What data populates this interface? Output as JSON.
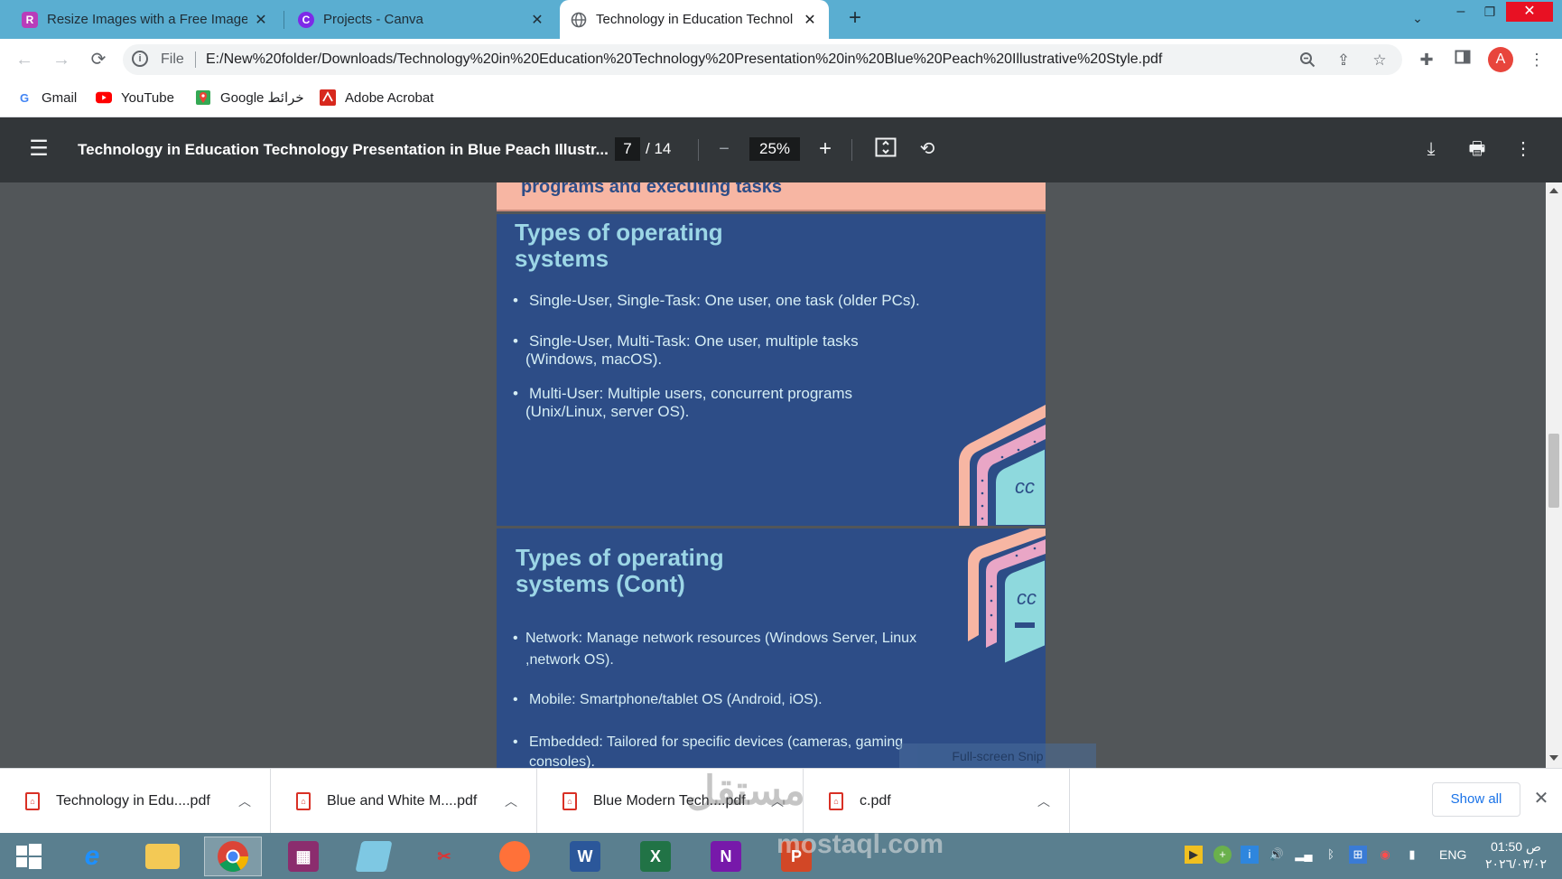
{
  "tabs": [
    {
      "title": "Resize Images with a Free Image",
      "icon": "R"
    },
    {
      "title": "Projects - Canva",
      "icon": "C"
    },
    {
      "title": "Technology in Education Technol",
      "icon": "globe"
    }
  ],
  "address": {
    "scheme_label": "File",
    "url": "E:/New%20folder/Downloads/Technology%20in%20Education%20Technology%20Presentation%20in%20Blue%20Peach%20Illustrative%20Style.pdf"
  },
  "profile_initial": "A",
  "bookmarks": [
    {
      "label": "Gmail",
      "icon": "G"
    },
    {
      "label": "YouTube",
      "icon": "youtube-icon"
    },
    {
      "label": "Google خرائط",
      "icon": "maps-icon"
    },
    {
      "label": "Adobe Acrobat",
      "icon": "acrobat-icon"
    }
  ],
  "pdf": {
    "title": "Technology in Education Technology Presentation in Blue Peach Illustr...",
    "page": "7",
    "total": "/ 14",
    "zoom": "25%"
  },
  "slides": {
    "prev_tail": "programs and executing tasks",
    "slide1": {
      "title_line1": "Types of operating",
      "title_line2": "systems",
      "bullets": [
        {
          "line1": "Single-User, Single-Task: One user, one task (older PCs).",
          "line2": ""
        },
        {
          "line1": "Single-User, Multi-Task: One user, multiple tasks",
          "line2": "(Windows, macOS)."
        },
        {
          "line1": "Multi-User: Multiple users, concurrent programs",
          "line2": "(Unix/Linux, server OS)."
        }
      ]
    },
    "slide2": {
      "title_line1": "Types of operating",
      "title_line2": "systems (Cont)",
      "bullets": [
        {
          "line1": "Network: Manage network resources (Windows Server, Linux",
          "line2": ",network OS)."
        },
        {
          "line1": "Mobile: Smartphone/tablet OS (Android, iOS).",
          "line2": ""
        },
        {
          "line1": "Embedded: Tailored for specific devices (cameras, gaming",
          "line2": "consoles)."
        }
      ]
    }
  },
  "snip_label": "Full-screen Snip",
  "downloads": [
    {
      "name": "Technology in Edu....pdf"
    },
    {
      "name": "Blue and White M....pdf"
    },
    {
      "name": "Blue Modern Tech....pdf"
    },
    {
      "name": "c.pdf"
    }
  ],
  "show_all": "Show all",
  "watermark": "مستقل",
  "watermark_url": "mostaql.com",
  "taskbar": {
    "lang": "ENG",
    "time": "01:50 ص",
    "date": "٢٠٢٦/٠٣/٠٢"
  },
  "colors": {
    "tabstrip": "#5aaed1",
    "slide_bg": "#2d4d87",
    "slide_title": "#9cd6e6",
    "peach": "#f7b6a3",
    "teal": "#8ed9dd",
    "pink": "#e9a6c6"
  }
}
